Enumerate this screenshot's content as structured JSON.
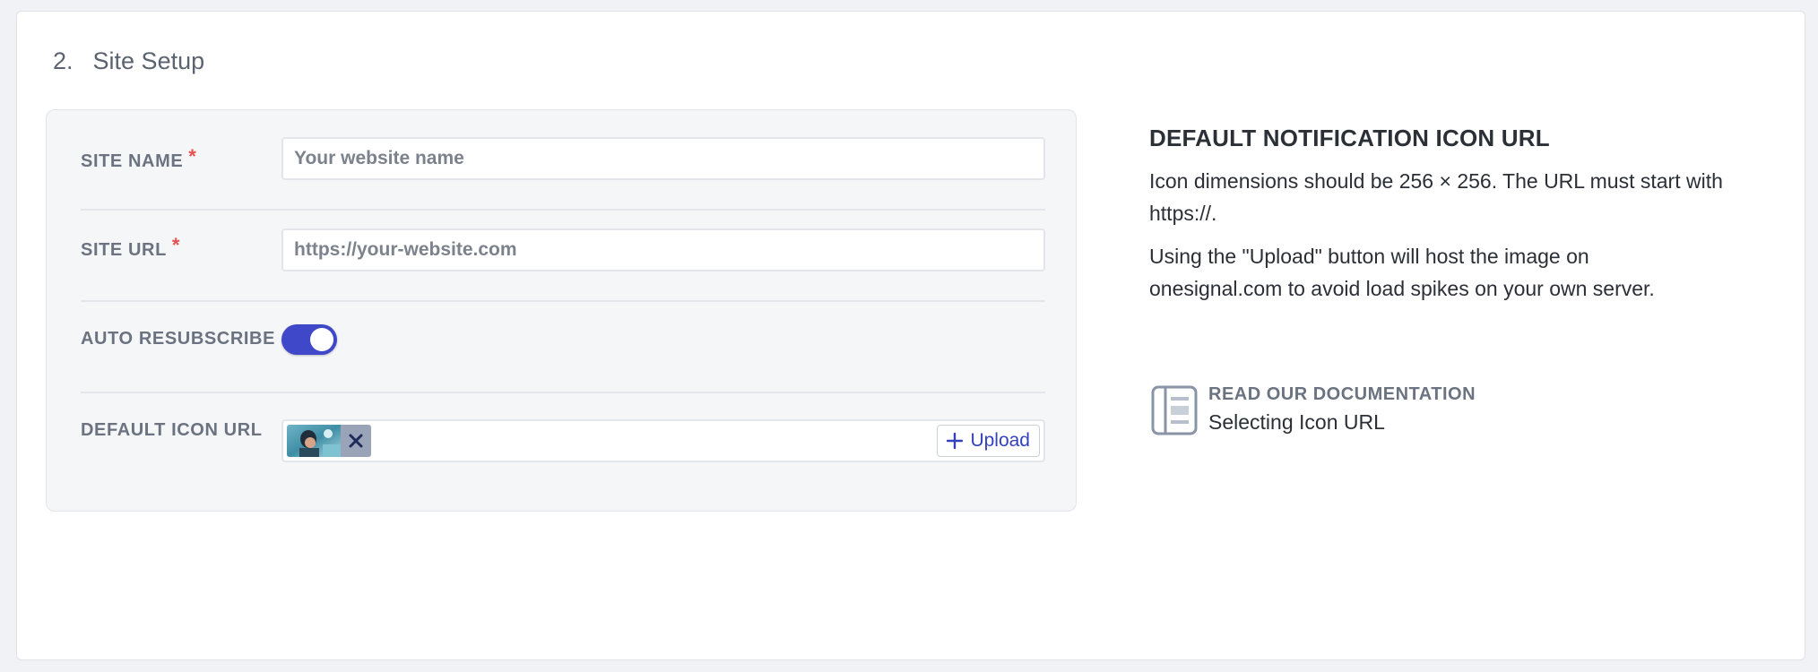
{
  "section": {
    "number": "2.",
    "title": "Site Setup"
  },
  "form": {
    "site_name": {
      "label": "SITE NAME",
      "required_mark": "*",
      "value": "",
      "placeholder": "Your website name"
    },
    "site_url": {
      "label": "SITE URL",
      "required_mark": "*",
      "value": "",
      "placeholder": "https://your-website.com"
    },
    "auto_resubscribe": {
      "label": "AUTO RESUBSCRIBE",
      "enabled": true
    },
    "default_icon_url": {
      "label": "DEFAULT ICON URL",
      "upload_label": "Upload"
    }
  },
  "info": {
    "title": "DEFAULT NOTIFICATION ICON URL",
    "paragraph1": "Icon dimensions should be 256 × 256. The URL must start with https://.",
    "paragraph2": "Using the \"Upload\" button will host the image on onesignal.com to avoid load spikes on your own server.",
    "doc_label": "READ OUR DOCUMENTATION",
    "doc_link": "Selecting Icon URL"
  },
  "icons": {
    "remove": "close-icon",
    "upload": "plus-icon",
    "documentation": "book-icon"
  },
  "colors": {
    "accent": "#3f48c8",
    "required": "#e5504f",
    "upload_text": "#3442b9"
  }
}
